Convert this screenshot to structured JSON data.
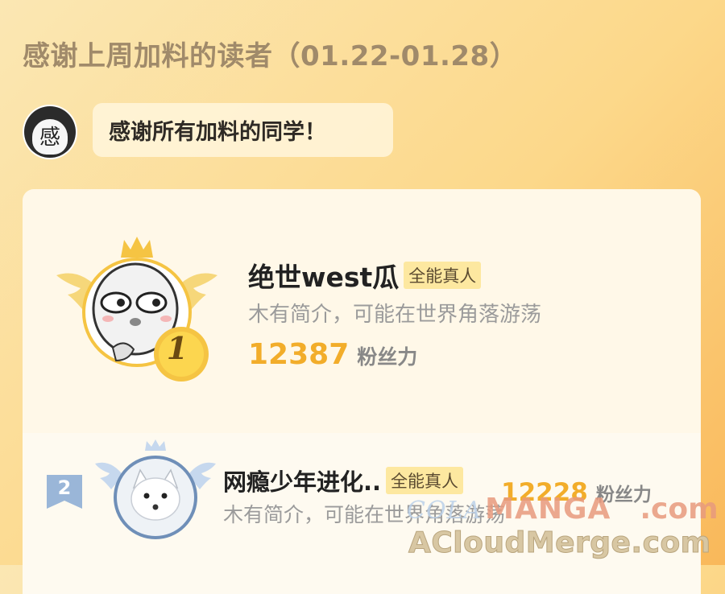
{
  "header": {
    "title": "感谢上周加料的读者（01.22-01.28）"
  },
  "author": {
    "avatar_glyph": "感",
    "message": "感谢所有加料的同学！"
  },
  "ranking": [
    {
      "rank": "1",
      "name": "绝世west瓜",
      "tag": "全能真人",
      "bio": "木有简介，可能在世界角落游荡",
      "score": "12387",
      "score_unit": "粉丝力"
    },
    {
      "rank": "2",
      "name": "网瘾少年进化..",
      "tag": "全能真人",
      "bio": "木有简介，可能在世界角落游荡",
      "score": "12228",
      "score_unit": "粉丝力"
    }
  ],
  "watermark": {
    "line1_a": "COLA",
    "line1_b": "MANGA",
    "line1_c": ".com",
    "line2": "ACloudMerge.com"
  },
  "colors": {
    "accent": "#f2ad2a",
    "tag_bg": "#fde8a0",
    "gold": "#f5c443"
  }
}
